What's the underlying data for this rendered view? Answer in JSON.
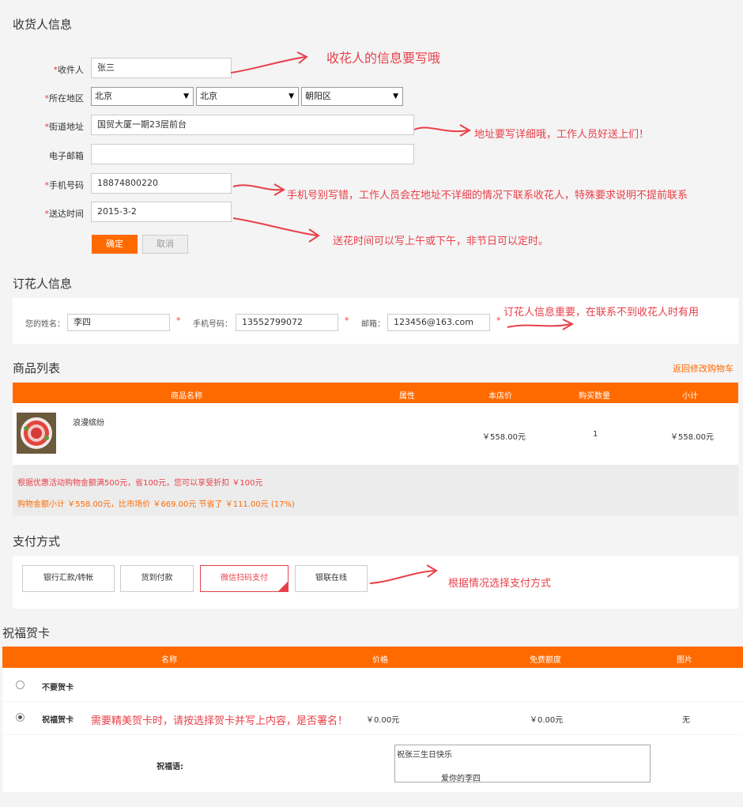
{
  "receiver": {
    "section_title": "收货人信息",
    "fields": {
      "name_label": "收件人",
      "name_value": "张三",
      "region_label": "所在地区",
      "province": "北京",
      "city": "北京",
      "district": "朝阳区",
      "street_label": "街道地址",
      "street_value": "国贸大厦一期23层前台",
      "email_label": "电子邮箱",
      "email_value": "",
      "phone_label": "手机号码",
      "phone_value": "18874800220",
      "time_label": "送达时间",
      "time_value": "2015-3-2"
    },
    "required_mark": "*",
    "confirm_label": "确定",
    "cancel_label": "取消"
  },
  "annotations": {
    "receiver_note": "收花人的信息要写哦",
    "address_note": "地址要写详细哦，工作人员好送上们！",
    "phone_note": "手机号别写错，工作人员会在地址不详细的情况下联系收花人，特殊要求说明不提前联系",
    "time_note": "送花时间可以写上午或下午，非节日可以定时。",
    "orderer_note": "订花人信息重要，在联系不到收花人时有用",
    "payment_note": "根据情况选择支付方式",
    "card_note": "需要精美贺卡时，请按选择贺卡并写上内容，是否署名！"
  },
  "orderer": {
    "section_title": "订花人信息",
    "name_label": "您的姓名：",
    "name_value": "李四",
    "phone_label": "手机号码：",
    "phone_value": "13552799072",
    "email_label": "邮箱：",
    "email_value": "123456@163.com",
    "star": "*"
  },
  "products": {
    "section_title": "商品列表",
    "back_link": "返回修改购物车",
    "headers": [
      "商品名称",
      "属性",
      "本店价",
      "购买数量",
      "小计"
    ],
    "rows": [
      {
        "name": "浪漫缤纷",
        "attr": "",
        "price": "￥558.00元",
        "qty": "1",
        "subtotal": "￥558.00元"
      }
    ],
    "promo_line": "根据优惠活动购物金额满500元，省100元，您可以享受折扣 ￥100元",
    "summary_line": "购物金额小计 ￥558.00元，比市场价 ￥669.00元 节省了 ￥111.00元 (17%)"
  },
  "payment": {
    "section_title": "支付方式",
    "options": [
      "银行汇款/转帐",
      "货到付款",
      "微信扫码支付",
      "银联在线"
    ],
    "selected": "微信扫码支付"
  },
  "card": {
    "section_title": "祝福贺卡",
    "headers": [
      "名称",
      "价格",
      "免费额度",
      "图片"
    ],
    "rows": [
      {
        "name": "不要贺卡",
        "price": "",
        "free": "",
        "image": "",
        "selected": false
      },
      {
        "name": "祝福贺卡",
        "price": "￥0.00元",
        "free": "￥0.00元",
        "image": "无",
        "selected": true
      }
    ],
    "message_label": "祝福语:",
    "message_line1": "祝张三生日快乐",
    "message_line2": "爱你的李四"
  },
  "colors": {
    "accent": "#ff6a00",
    "annotation": "#e8404a"
  }
}
